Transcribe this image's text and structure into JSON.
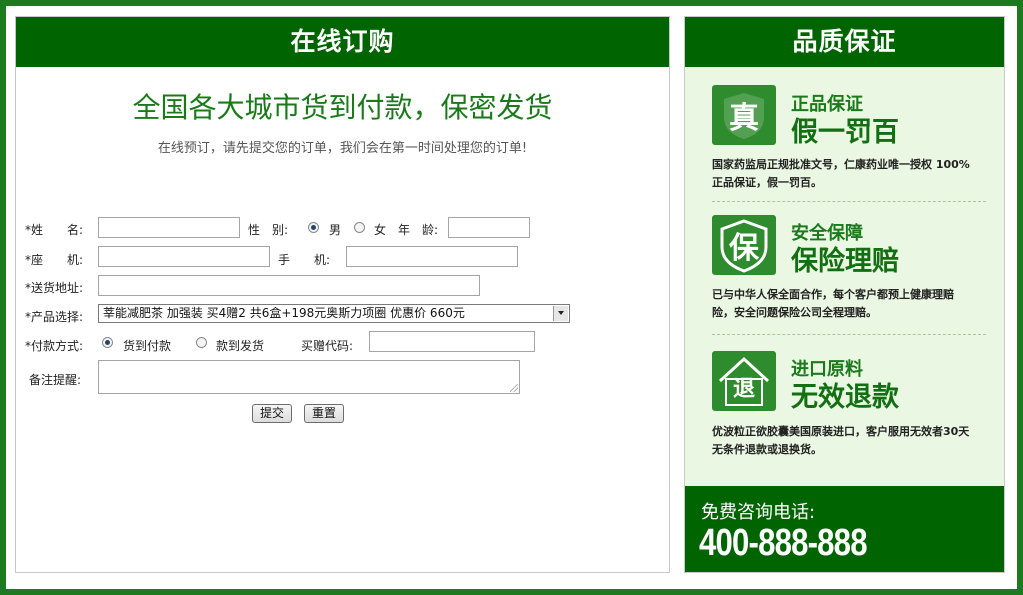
{
  "order": {
    "title": "在线订购",
    "headline": "全国各大城市货到付款，保密发货",
    "subline": "在线预订，请先提交您的订单，我们会在第一时间处理您的订单!",
    "labels": {
      "name": "*姓　　名:",
      "gender": "性　别:",
      "male": "男",
      "female": "女",
      "age": "年　龄:",
      "phone": "*座　　机:",
      "mobile": "手　　机:",
      "address": "*送货地址:",
      "product": "*产品选择:",
      "payment": "*付款方式:",
      "cod": "货到付款",
      "prepay": "款到发货",
      "referral": "买赠代码:",
      "remark": "备注提醒:"
    },
    "product_selected": "莘能减肥茶 加强装 买4赠2 共6盒+198元奥斯力项圈 优惠价 660元",
    "submit_label": "提交",
    "reset_label": "重置"
  },
  "quality": {
    "title": "品质保证",
    "items": [
      {
        "icon": "真",
        "title1": "正品保证",
        "title2": "假一罚百",
        "desc": "国家药监局正规批准文号，仁康药业唯一授权 100%正品保证，假一罚百。"
      },
      {
        "icon": "保",
        "title1": "安全保障",
        "title2": "保险理赔",
        "desc": "已与中华人保全面合作，每个客户都预上健康理赔险，安全问题保险公司全程理赔。"
      },
      {
        "icon": "退",
        "title1": "进口原料",
        "title2": "无效退款",
        "desc": "优波粒正欲胶囊美国原装进口，客户服用无效者30天无条件退款或退换货。"
      }
    ],
    "hotline_label": "免费咨询电话:",
    "hotline_number": "400-888-888"
  },
  "colors": {
    "brand_green": "#006400",
    "panel_bg": "#eaf7e2"
  }
}
